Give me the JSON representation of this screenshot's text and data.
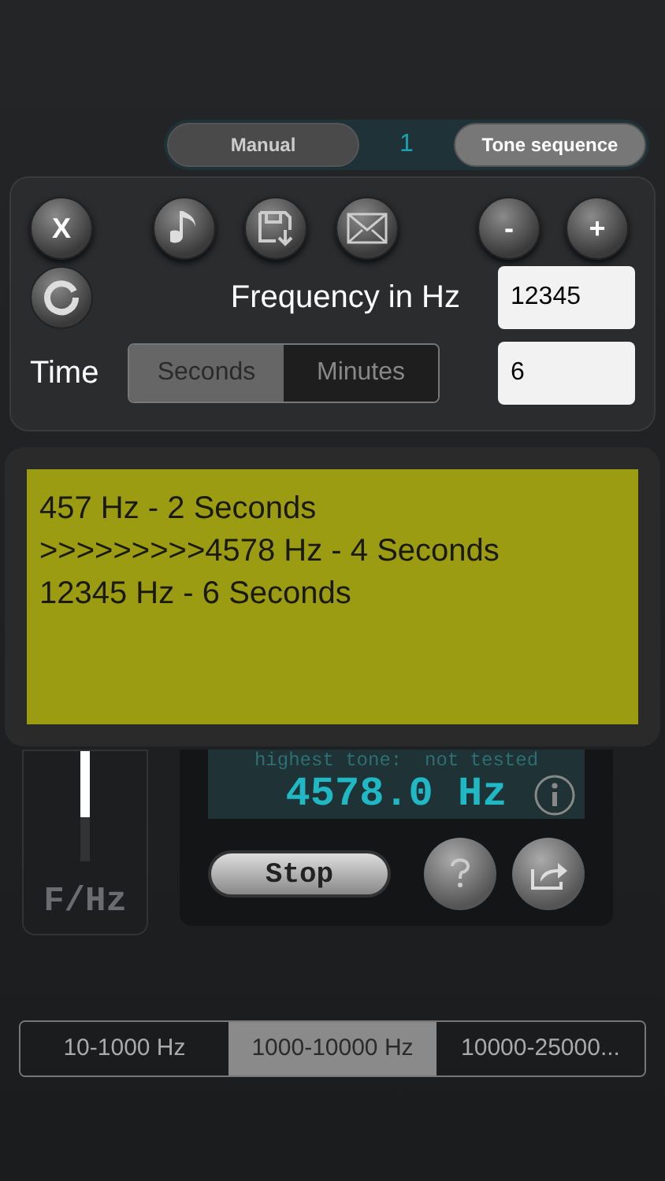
{
  "mode_bar": {
    "buttons": [
      {
        "label": "Manual",
        "selected": false
      },
      {
        "label": "Tone sequence",
        "selected": true
      }
    ],
    "counter": "1"
  },
  "editor": {
    "buttons": [
      {
        "kind": "close",
        "label": "X"
      },
      {
        "kind": "music"
      },
      {
        "kind": "save"
      },
      {
        "kind": "mail"
      },
      {
        "kind": "minus",
        "label": "-"
      },
      {
        "kind": "plus",
        "label": "+"
      }
    ],
    "frequency_label": "Frequency in Hz",
    "frequency_value": "12345",
    "time_label": "Time",
    "time_units": [
      {
        "label": "Seconds",
        "selected": true
      },
      {
        "label": "Minutes",
        "selected": false
      }
    ],
    "time_value": "6"
  },
  "sequence": {
    "lines": [
      "457 Hz - 2 Seconds",
      ">>>>>>>>>4578 Hz - 4 Seconds",
      "12345 Hz - 6 Seconds"
    ]
  },
  "slider": {
    "label": "F/Hz",
    "level": 0.6
  },
  "display": {
    "status": "highest tone:  not tested",
    "frequency": "4578.0 Hz"
  },
  "stop_button": "Stop",
  "ranges": [
    {
      "label": "10-1000 Hz",
      "selected": false
    },
    {
      "label": "1000-10000 Hz",
      "selected": true
    },
    {
      "label": "10000-25000...",
      "selected": false
    }
  ]
}
